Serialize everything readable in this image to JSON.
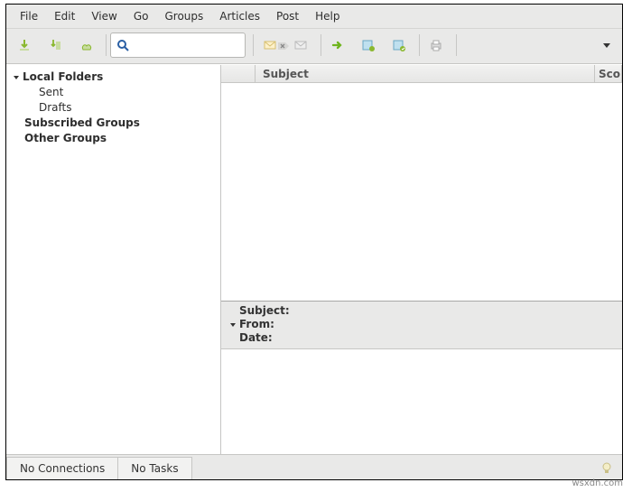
{
  "menu": {
    "file": "File",
    "edit": "Edit",
    "view": "View",
    "go": "Go",
    "groups": "Groups",
    "articles": "Articles",
    "post": "Post",
    "help": "Help"
  },
  "toolbar": {
    "search_placeholder": ""
  },
  "sidebar": {
    "local_folders": {
      "label": "Local Folders"
    },
    "sent": {
      "label": "Sent"
    },
    "drafts": {
      "label": "Drafts"
    },
    "subscribed_groups": {
      "label": "Subscribed Groups"
    },
    "other_groups": {
      "label": "Other Groups"
    }
  },
  "thread_header": {
    "flag": "",
    "subject": "Subject",
    "score": "Sco"
  },
  "message_header": {
    "subject": "Subject:",
    "from": "From:",
    "date": "Date:"
  },
  "status": {
    "no_connections": "No Connections",
    "no_tasks": "No Tasks"
  },
  "watermark": "wsxdn.com"
}
